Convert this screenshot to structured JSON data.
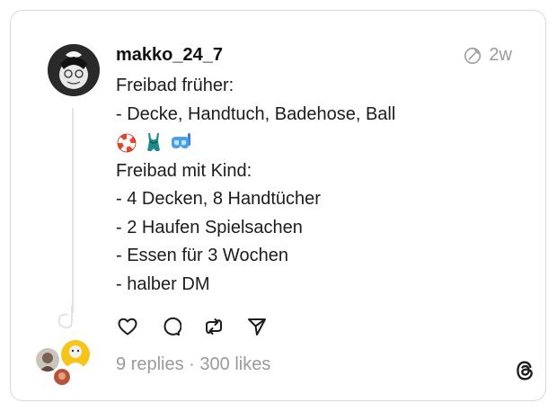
{
  "post": {
    "username": "makko_24_7",
    "time": "2w",
    "lines": [
      "Freibad früher:",
      "- Decke, Handtuch, Badehose, Ball",
      "Freibad mit Kind:",
      "- 4 Decken, 8 Handtücher",
      "- 2 Haufen Spielsachen",
      "- Essen für 3 Wochen",
      "- halber DM"
    ],
    "emojis": [
      "lifebuoy-icon",
      "swimsuit-icon",
      "diving-mask-icon"
    ]
  },
  "stats": {
    "replies": "9 replies",
    "separator": " · ",
    "likes": "300 likes"
  },
  "icons": {
    "like": "heart-icon",
    "reply": "speech-bubble-icon",
    "repost": "repost-icon",
    "share": "send-icon",
    "brand": "threads-logo-icon",
    "edited": "edited-circle-icon"
  },
  "colors": {
    "text": "#1c1c1c",
    "muted": "#9a9a9a",
    "border": "#d9d9d9"
  }
}
